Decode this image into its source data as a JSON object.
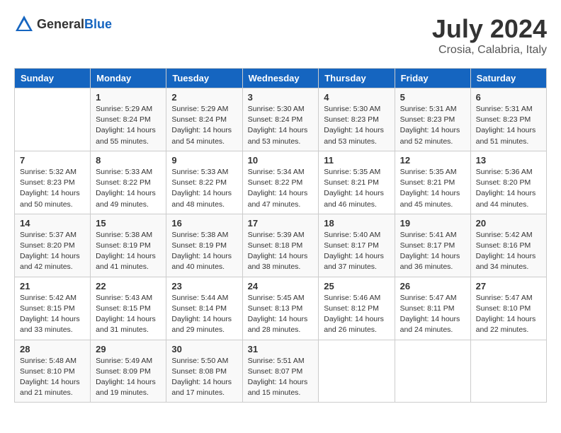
{
  "logo": {
    "text_general": "General",
    "text_blue": "Blue"
  },
  "header": {
    "month_year": "July 2024",
    "location": "Crosia, Calabria, Italy"
  },
  "days_of_week": [
    "Sunday",
    "Monday",
    "Tuesday",
    "Wednesday",
    "Thursday",
    "Friday",
    "Saturday"
  ],
  "weeks": [
    [
      {
        "day": "",
        "info": ""
      },
      {
        "day": "1",
        "info": "Sunrise: 5:29 AM\nSunset: 8:24 PM\nDaylight: 14 hours\nand 55 minutes."
      },
      {
        "day": "2",
        "info": "Sunrise: 5:29 AM\nSunset: 8:24 PM\nDaylight: 14 hours\nand 54 minutes."
      },
      {
        "day": "3",
        "info": "Sunrise: 5:30 AM\nSunset: 8:24 PM\nDaylight: 14 hours\nand 53 minutes."
      },
      {
        "day": "4",
        "info": "Sunrise: 5:30 AM\nSunset: 8:23 PM\nDaylight: 14 hours\nand 53 minutes."
      },
      {
        "day": "5",
        "info": "Sunrise: 5:31 AM\nSunset: 8:23 PM\nDaylight: 14 hours\nand 52 minutes."
      },
      {
        "day": "6",
        "info": "Sunrise: 5:31 AM\nSunset: 8:23 PM\nDaylight: 14 hours\nand 51 minutes."
      }
    ],
    [
      {
        "day": "7",
        "info": "Sunrise: 5:32 AM\nSunset: 8:23 PM\nDaylight: 14 hours\nand 50 minutes."
      },
      {
        "day": "8",
        "info": "Sunrise: 5:33 AM\nSunset: 8:22 PM\nDaylight: 14 hours\nand 49 minutes."
      },
      {
        "day": "9",
        "info": "Sunrise: 5:33 AM\nSunset: 8:22 PM\nDaylight: 14 hours\nand 48 minutes."
      },
      {
        "day": "10",
        "info": "Sunrise: 5:34 AM\nSunset: 8:22 PM\nDaylight: 14 hours\nand 47 minutes."
      },
      {
        "day": "11",
        "info": "Sunrise: 5:35 AM\nSunset: 8:21 PM\nDaylight: 14 hours\nand 46 minutes."
      },
      {
        "day": "12",
        "info": "Sunrise: 5:35 AM\nSunset: 8:21 PM\nDaylight: 14 hours\nand 45 minutes."
      },
      {
        "day": "13",
        "info": "Sunrise: 5:36 AM\nSunset: 8:20 PM\nDaylight: 14 hours\nand 44 minutes."
      }
    ],
    [
      {
        "day": "14",
        "info": "Sunrise: 5:37 AM\nSunset: 8:20 PM\nDaylight: 14 hours\nand 42 minutes."
      },
      {
        "day": "15",
        "info": "Sunrise: 5:38 AM\nSunset: 8:19 PM\nDaylight: 14 hours\nand 41 minutes."
      },
      {
        "day": "16",
        "info": "Sunrise: 5:38 AM\nSunset: 8:19 PM\nDaylight: 14 hours\nand 40 minutes."
      },
      {
        "day": "17",
        "info": "Sunrise: 5:39 AM\nSunset: 8:18 PM\nDaylight: 14 hours\nand 38 minutes."
      },
      {
        "day": "18",
        "info": "Sunrise: 5:40 AM\nSunset: 8:17 PM\nDaylight: 14 hours\nand 37 minutes."
      },
      {
        "day": "19",
        "info": "Sunrise: 5:41 AM\nSunset: 8:17 PM\nDaylight: 14 hours\nand 36 minutes."
      },
      {
        "day": "20",
        "info": "Sunrise: 5:42 AM\nSunset: 8:16 PM\nDaylight: 14 hours\nand 34 minutes."
      }
    ],
    [
      {
        "day": "21",
        "info": "Sunrise: 5:42 AM\nSunset: 8:15 PM\nDaylight: 14 hours\nand 33 minutes."
      },
      {
        "day": "22",
        "info": "Sunrise: 5:43 AM\nSunset: 8:15 PM\nDaylight: 14 hours\nand 31 minutes."
      },
      {
        "day": "23",
        "info": "Sunrise: 5:44 AM\nSunset: 8:14 PM\nDaylight: 14 hours\nand 29 minutes."
      },
      {
        "day": "24",
        "info": "Sunrise: 5:45 AM\nSunset: 8:13 PM\nDaylight: 14 hours\nand 28 minutes."
      },
      {
        "day": "25",
        "info": "Sunrise: 5:46 AM\nSunset: 8:12 PM\nDaylight: 14 hours\nand 26 minutes."
      },
      {
        "day": "26",
        "info": "Sunrise: 5:47 AM\nSunset: 8:11 PM\nDaylight: 14 hours\nand 24 minutes."
      },
      {
        "day": "27",
        "info": "Sunrise: 5:47 AM\nSunset: 8:10 PM\nDaylight: 14 hours\nand 22 minutes."
      }
    ],
    [
      {
        "day": "28",
        "info": "Sunrise: 5:48 AM\nSunset: 8:10 PM\nDaylight: 14 hours\nand 21 minutes."
      },
      {
        "day": "29",
        "info": "Sunrise: 5:49 AM\nSunset: 8:09 PM\nDaylight: 14 hours\nand 19 minutes."
      },
      {
        "day": "30",
        "info": "Sunrise: 5:50 AM\nSunset: 8:08 PM\nDaylight: 14 hours\nand 17 minutes."
      },
      {
        "day": "31",
        "info": "Sunrise: 5:51 AM\nSunset: 8:07 PM\nDaylight: 14 hours\nand 15 minutes."
      },
      {
        "day": "",
        "info": ""
      },
      {
        "day": "",
        "info": ""
      },
      {
        "day": "",
        "info": ""
      }
    ]
  ]
}
